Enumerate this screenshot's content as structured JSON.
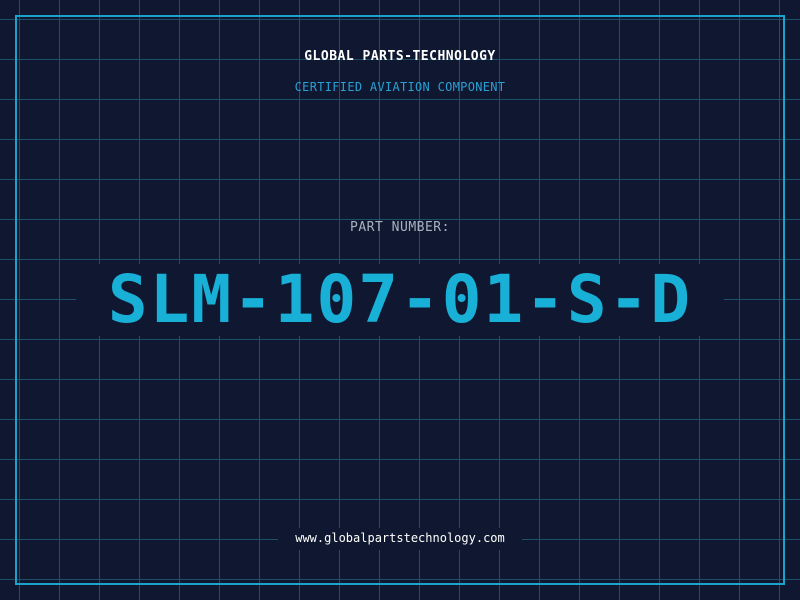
{
  "header": {
    "company": "GLOBAL PARTS-TECHNOLOGY",
    "subtitle": "CERTIFIED AVIATION COMPONENT"
  },
  "part": {
    "label": "PART NUMBER:",
    "number": "SLM-107-01-S-D"
  },
  "footer": {
    "url": "www.globalpartstechnology.com"
  },
  "colors": {
    "background": "#0f1830",
    "grid": "#1f4f68",
    "accent": "#19b0d8",
    "frame": "#1aa3c8"
  }
}
